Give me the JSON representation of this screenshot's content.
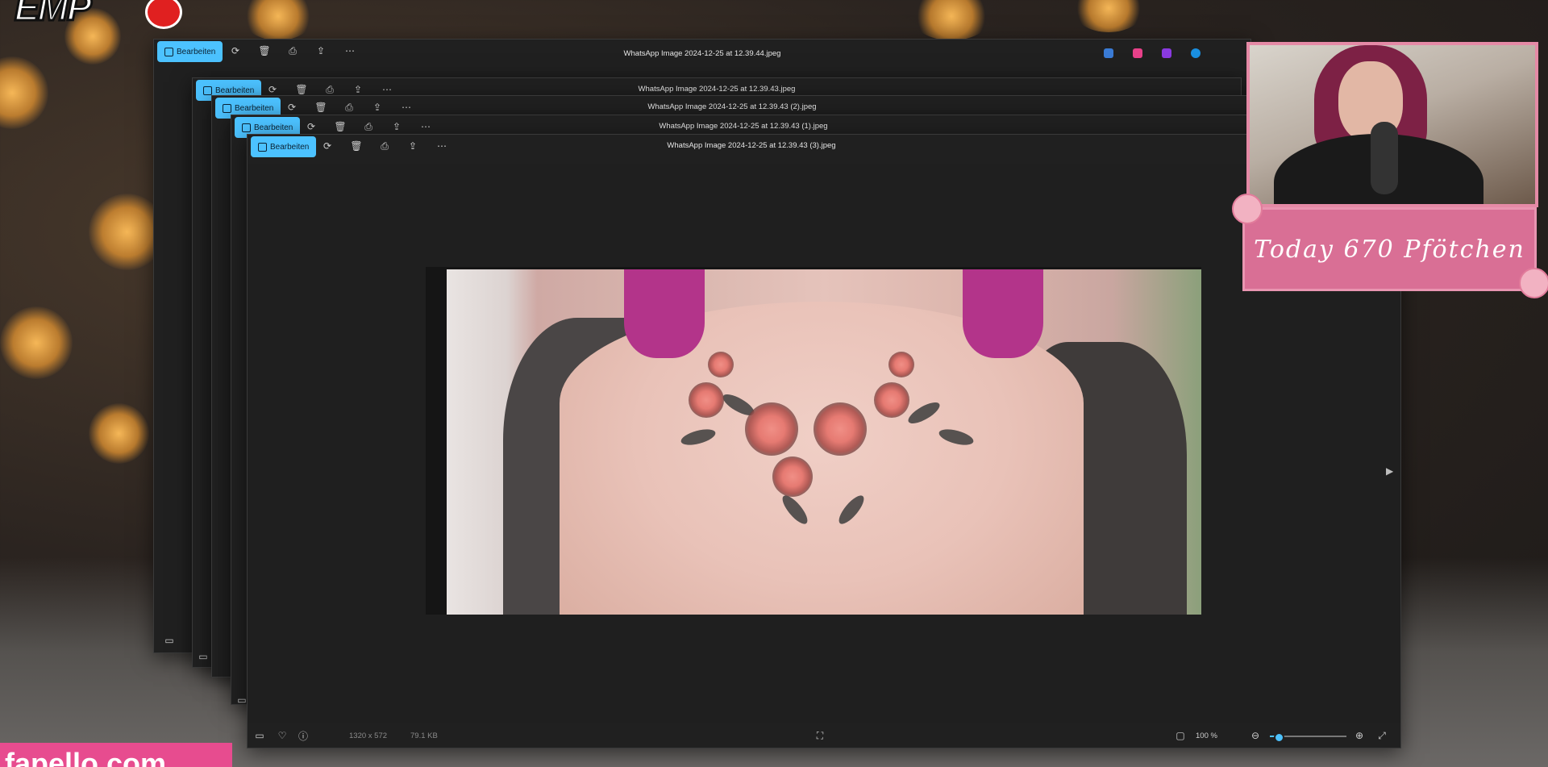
{
  "background": {
    "style": "bokeh-lights"
  },
  "overlay": {
    "logo_text": "EMP",
    "webcam_banner_text": "Today 670 Pfötchen",
    "watermark_text": "fapello.com"
  },
  "windows": [
    {
      "title": "WhatsApp Image 2024-12-25 at 12.39.44.jpeg",
      "edit_label": "Bearbeiten"
    },
    {
      "title": "WhatsApp Image 2024-12-25 at 12.39.43.jpeg",
      "edit_label": "Bearbeiten"
    },
    {
      "title": "WhatsApp Image 2024-12-25 at 12.39.43 (2).jpeg",
      "edit_label": "Bearbeiten"
    },
    {
      "title": "WhatsApp Image 2024-12-25 at 12.39.43 (1).jpeg",
      "edit_label": "Bearbeiten"
    },
    {
      "title": "WhatsApp Image 2024-12-25 at 12.39.43 (3).jpeg",
      "edit_label": "Bearbeiten"
    }
  ],
  "viewer": {
    "dimensions": "1320 x 572",
    "file_size": "79.1 KB",
    "zoom": "100 %",
    "zoom_fraction": 0.12
  },
  "icons": {
    "edit": "edit-icon",
    "rotate": "rotate-icon",
    "delete": "trash-icon",
    "print": "print-icon",
    "share": "share-icon",
    "more": "more-icon",
    "filmstrip": "filmstrip-icon",
    "favorite": "heart-icon",
    "info": "info-icon",
    "fit": "fit-screen-icon",
    "zoom_out": "zoom-out-icon",
    "zoom_in": "zoom-in-icon",
    "fullscreen": "fullscreen-icon",
    "next": "next-arrow-icon"
  },
  "colors": {
    "accent": "#4cc2ff",
    "window_bg": "#202020",
    "banner_pink": "#d96f95"
  }
}
